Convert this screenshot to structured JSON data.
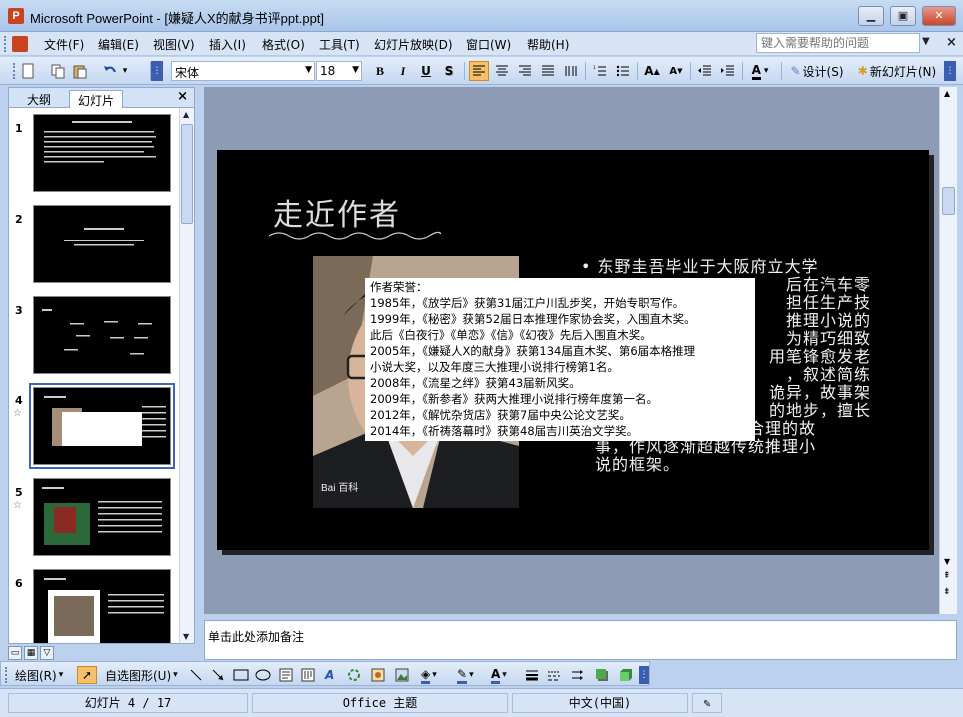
{
  "window": {
    "title": "Microsoft PowerPoint - [嫌疑人X的献身书评ppt.ppt]",
    "minimize": "▁",
    "maximize": "▣",
    "close": "✕"
  },
  "menu": {
    "items": [
      "文件(F)",
      "编辑(E)",
      "视图(V)",
      "插入(I)",
      "格式(O)",
      "工具(T)",
      "幻灯片放映(D)",
      "窗口(W)",
      "帮助(H)"
    ],
    "help_placeholder": "键入需要帮助的问题"
  },
  "toolbar": {
    "font_name": "宋体",
    "font_size": "18",
    "bold": "B",
    "italic": "I",
    "underline": "U",
    "shadow": "S",
    "design": "设计(S)",
    "new_slide": "新幻灯片(N)"
  },
  "left_panel": {
    "tab_outline": "大纲",
    "tab_slides": "幻灯片",
    "close": "×",
    "slides": [
      {
        "num": "1"
      },
      {
        "num": "2"
      },
      {
        "num": "3"
      },
      {
        "num": "4",
        "star": "☆"
      },
      {
        "num": "5",
        "star": "☆"
      },
      {
        "num": "6"
      }
    ]
  },
  "slide": {
    "title": "走近作者",
    "bullet": "东野圭吾毕业于大阪府立大学电气工学专业，之后在汽车零件供应商日本电装担任生产技术工程师，同时开始推理小说的创作。作品以行文流畅、布局精巧细致、情节跌宕起伏著称，笔锋愈发老辣，叙述简练凶狠，故事架构几至匪夷所思的地步，擅长从极不合理处写出极合理的故事，作风逐渐超越传统推理小说的框架。",
    "bullet_visible_lines": [
      "• 东野圭吾毕业于大阪府立大学",
      "后在汽车零",
      "担任生产技",
      "推理小说的",
      "为精巧细致",
      "用笔锋愈发老",
      "，叙述简练",
      "诡异，故事架",
      "的地步，擅长",
      "从极不合理处写出极合理的故",
      "事，作风逐渐超越传统推理小",
      "说的框架。"
    ],
    "watermark": "Bai 百科",
    "popup": {
      "heading": "作者荣誉：",
      "lines": [
        "1985年，《放学后》获第31届江户川乱步奖，开始专职写作。",
        "1999年，《秘密》获第52届日本推理作家协会奖，入围直木奖。",
        "此后《白夜行》《单恋》《信》《幻夜》先后入围直木奖。",
        "2005年，《嫌疑人X的献身》获第134届直木奖、第6届本格推理",
        "小说大奖，以及年度三大推理小说排行榜第1名。",
        "2008年，《流星之绊》获第43届新风奖。",
        "2009年，《新参者》获两大推理小说排行榜年度第一名。",
        "2012年，《解忧杂货店》获第7届中央公论文艺奖。",
        "2014年，《祈祷落幕时》获第48届吉川英治文学奖。"
      ]
    }
  },
  "notes": {
    "placeholder": "单击此处添加备注"
  },
  "drawing": {
    "draw": "绘图(R)",
    "autoshapes": "自选图形(U)"
  },
  "status": {
    "slide": "幻灯片 4 / 17",
    "theme": "Office 主题",
    "language": "中文(中国)"
  }
}
